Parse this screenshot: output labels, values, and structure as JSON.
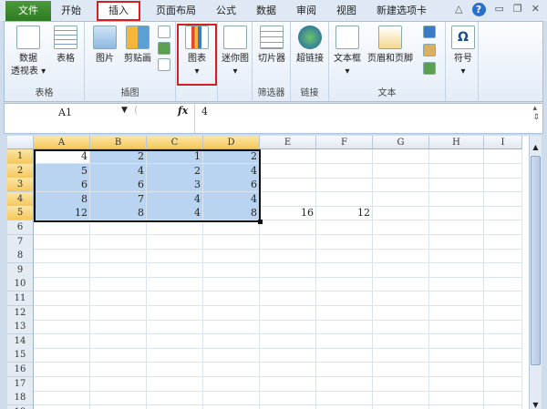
{
  "tabs": [
    "文件",
    "开始",
    "插入",
    "页面布局",
    "公式",
    "数据",
    "审阅",
    "视图",
    "新建选项卡"
  ],
  "active_tab": "插入",
  "ribbon": {
    "groups": [
      {
        "label": "表格"
      },
      {
        "label": "插图"
      },
      {
        "label": ""
      },
      {
        "label": ""
      },
      {
        "label": "筛选器"
      },
      {
        "label": "链接"
      },
      {
        "label": "文本"
      },
      {
        "label": ""
      }
    ],
    "buttons": {
      "pivot": "数据\n透视表 ▾",
      "table": "表格",
      "picture": "图片",
      "clipart": "剪贴画",
      "chart": "图表",
      "chart_arrow": "▾",
      "sparkline": "迷你图",
      "sparkline_arrow": "▾",
      "slicer": "切片器",
      "hyperlink": "超链接",
      "textbox": "文本框",
      "textbox_arrow": "▾",
      "header_footer": "页眉和页脚",
      "symbol": "符号",
      "symbol_arrow": "▾"
    }
  },
  "formula_bar": {
    "name_box": "A1",
    "fx": "fx",
    "value": "4"
  },
  "sheet": {
    "columns": [
      "A",
      "B",
      "C",
      "D",
      "E",
      "F",
      "G",
      "H",
      "I"
    ],
    "row_count": 19,
    "cells": {
      "1": [
        "4",
        "2",
        "1",
        "2"
      ],
      "2": [
        "5",
        "4",
        "2",
        "4"
      ],
      "3": [
        "6",
        "6",
        "3",
        "6"
      ],
      "4": [
        "8",
        "7",
        "4",
        "4"
      ],
      "5": [
        "12",
        "8",
        "4",
        "8",
        "16",
        "12"
      ]
    },
    "selection": "A1:D5"
  },
  "colors": {
    "selection": "#b9d4f0",
    "highlight": "#d42020",
    "file_tab": "#2e7a22"
  }
}
